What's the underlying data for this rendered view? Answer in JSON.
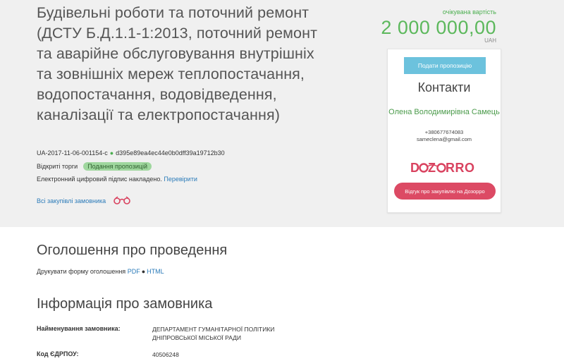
{
  "tender": {
    "title": "Будівельні роботи та поточний ремонт (ДСТУ Б.Д.1.1-1:2013, поточний ремонт та аварійне обслуговування внутрішніх та зовнішніх мереж теплопостачання, водопостачання, водовідведення, каналізації та електропостачання)",
    "id": "UA-2017-11-06-001154-c",
    "hash": "d395e89ea4ec44e0b0dff39a19712b30",
    "procedure": "Відкриті торги",
    "status_badge": "Подання пропозицій",
    "signature_text": "Електронний цифровий підпис накладено.",
    "signature_link": "Перевірити",
    "all_purchases_link": "Всі закупівлі замовника"
  },
  "price": {
    "label": "очікувана вартість",
    "value": "2 000 000,00",
    "currency": "UAH"
  },
  "card": {
    "offer_button": "Подати пропозицію",
    "contacts_title": "Контакти",
    "contact_name": "Олена Володимирівна Самець",
    "phone": "+380677674083",
    "email": "sameclena@gmail.com",
    "dozorro_logo": "DOZORRO",
    "review_button": "Відгук про закупівлю на Дозорро"
  },
  "announcement": {
    "heading": "Оголошення про проведення",
    "print_label": "Друкувати форму оголошення",
    "pdf": "PDF",
    "html": "HTML"
  },
  "customer": {
    "heading": "Інформація про замовника",
    "name_label": "Найменування замовника:",
    "name_value": "Департамент гуманітарної політики Дніпровської міської ради",
    "code_label": "Код ЄДРПОУ:",
    "code_value": "40506248"
  },
  "colors": {
    "accent_green": "#5cb85c",
    "offer_button": "#6cc2dd",
    "dozorro_red": "#d9425f",
    "link_blue": "#2b7bb9"
  }
}
